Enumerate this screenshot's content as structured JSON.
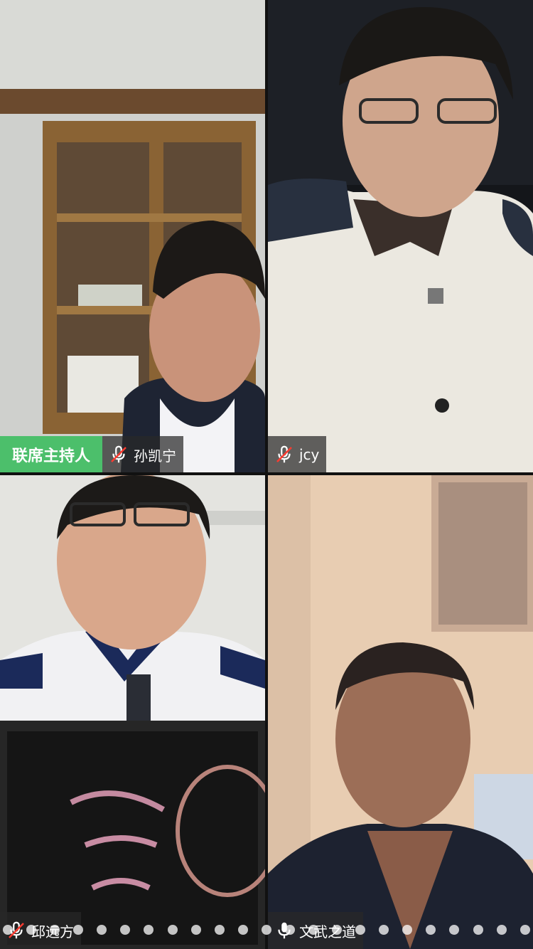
{
  "host_badge": "联席主持人",
  "participants": [
    {
      "name": "孙凯宁",
      "mic": "mic-muted-icon"
    },
    {
      "name": "jcy",
      "mic": "mic-muted-icon"
    },
    {
      "name": "邱远方",
      "mic": "mic-muted-icon"
    },
    {
      "name": "文武之道",
      "mic": "mic-icon"
    }
  ],
  "pagination": {
    "dot_count": 23
  }
}
